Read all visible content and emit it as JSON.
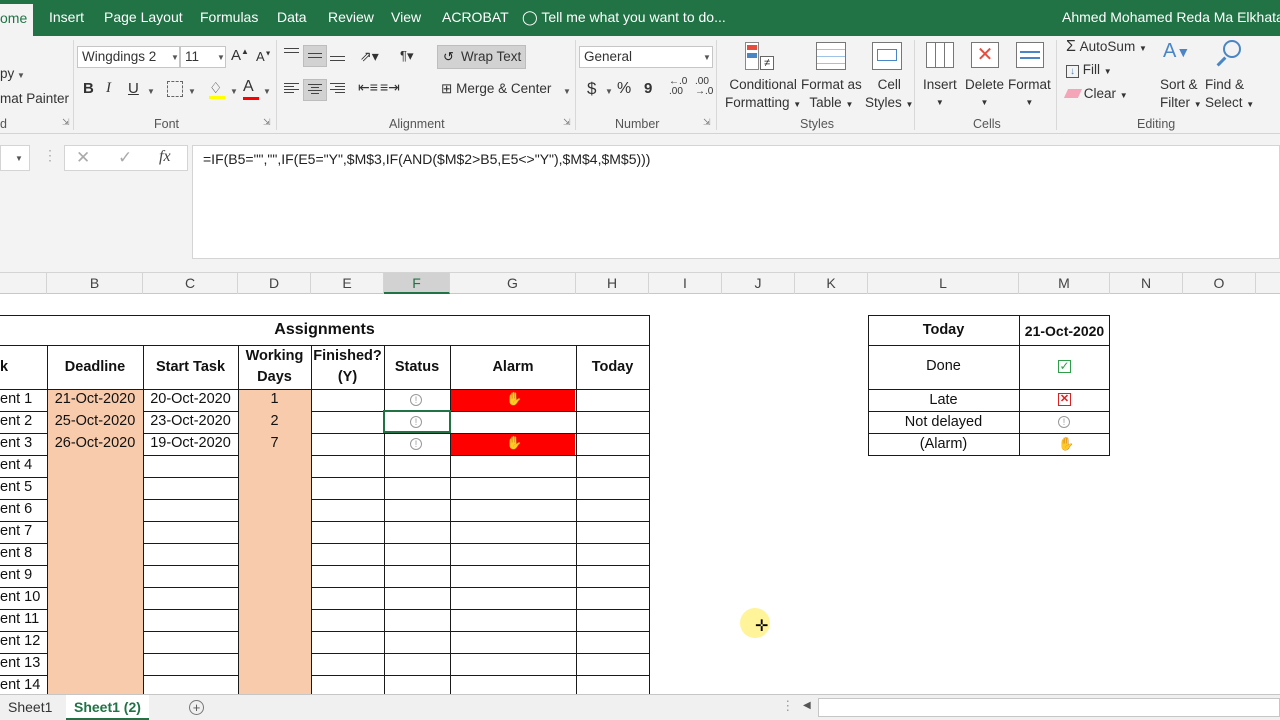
{
  "ribbon_tabs": [
    "ome",
    "Insert",
    "Page Layout",
    "Formulas",
    "Data",
    "Review",
    "View",
    "ACROBAT"
  ],
  "tell_me": "Tell me what you want to do...",
  "user_name": "Ahmed Mohamed Reda Ma Elkhatat",
  "clipboard": {
    "copy": "py",
    "format_painter": "mat Painter",
    "label": "d"
  },
  "font": {
    "name": "Wingdings 2",
    "size": "11",
    "label": "Font",
    "bold": "B",
    "italic": "I",
    "underline": "U"
  },
  "alignment": {
    "wrap_text": "Wrap Text",
    "merge_center": "Merge & Center",
    "label": "Alignment"
  },
  "number": {
    "format": "General",
    "currency": "$",
    "percent": "%",
    "comma": "9",
    "label": "Number"
  },
  "styles": {
    "conditional": [
      "Conditional",
      "Formatting"
    ],
    "format_table": [
      "Format as",
      "Table"
    ],
    "cell_styles": [
      "Cell",
      "Styles"
    ],
    "label": "Styles"
  },
  "cells": {
    "insert": "Insert",
    "delete": "Delete",
    "format": "Format",
    "label": "Cells"
  },
  "editing": {
    "autosum": "AutoSum",
    "fill": "Fill",
    "clear": "Clear",
    "sort_filter": [
      "Sort &",
      "Filter"
    ],
    "find_select": [
      "Find &",
      "Select"
    ],
    "label": "Editing"
  },
  "formula": "=IF(B5=\"\",\"\",IF(E5=\"Y\",$M$3,IF(AND($M$2>B5,E5<>\"Y\"),$M$4,$M$5)))",
  "columns": [
    "B",
    "C",
    "D",
    "E",
    "F",
    "G",
    "H",
    "I",
    "J",
    "K",
    "L",
    "M",
    "N",
    "O"
  ],
  "selected_column": "F",
  "table": {
    "title": "Assignments",
    "headers": {
      "task": "k",
      "deadline": "Deadline",
      "start": "Start Task",
      "working": [
        "Working",
        "Days"
      ],
      "finished": [
        "Finished?",
        "(Y)"
      ],
      "status": "Status",
      "alarm": "Alarm",
      "today": "Today"
    },
    "rows": [
      {
        "task": "ent 1",
        "deadline": "21-Oct-2020",
        "start": "20-Oct-2020",
        "days": "1",
        "alarm": true
      },
      {
        "task": "ent 2",
        "deadline": "25-Oct-2020",
        "start": "23-Oct-2020",
        "days": "2",
        "alarm": false
      },
      {
        "task": "ent 3",
        "deadline": "26-Oct-2020",
        "start": "19-Oct-2020",
        "days": "7",
        "alarm": true
      },
      {
        "task": "ent 4"
      },
      {
        "task": "ent 5"
      },
      {
        "task": "ent 6"
      },
      {
        "task": "ent 7"
      },
      {
        "task": "ent 8"
      },
      {
        "task": "ent 9"
      },
      {
        "task": "ent 10"
      },
      {
        "task": "ent 11"
      },
      {
        "task": "ent 12"
      },
      {
        "task": "ent 13"
      },
      {
        "task": "ent 14"
      }
    ]
  },
  "legend": {
    "today_label": "Today",
    "today_value": "21-Oct-2020",
    "done": "Done",
    "late": "Late",
    "not_delayed": "Not delayed",
    "alarm": "(Alarm)"
  },
  "sheets": [
    "Sheet1",
    "Sheet1 (2)"
  ],
  "colors": {
    "excel_green": "#217346",
    "shade": "#f8cbad",
    "alarm_red": "#ff0000"
  }
}
